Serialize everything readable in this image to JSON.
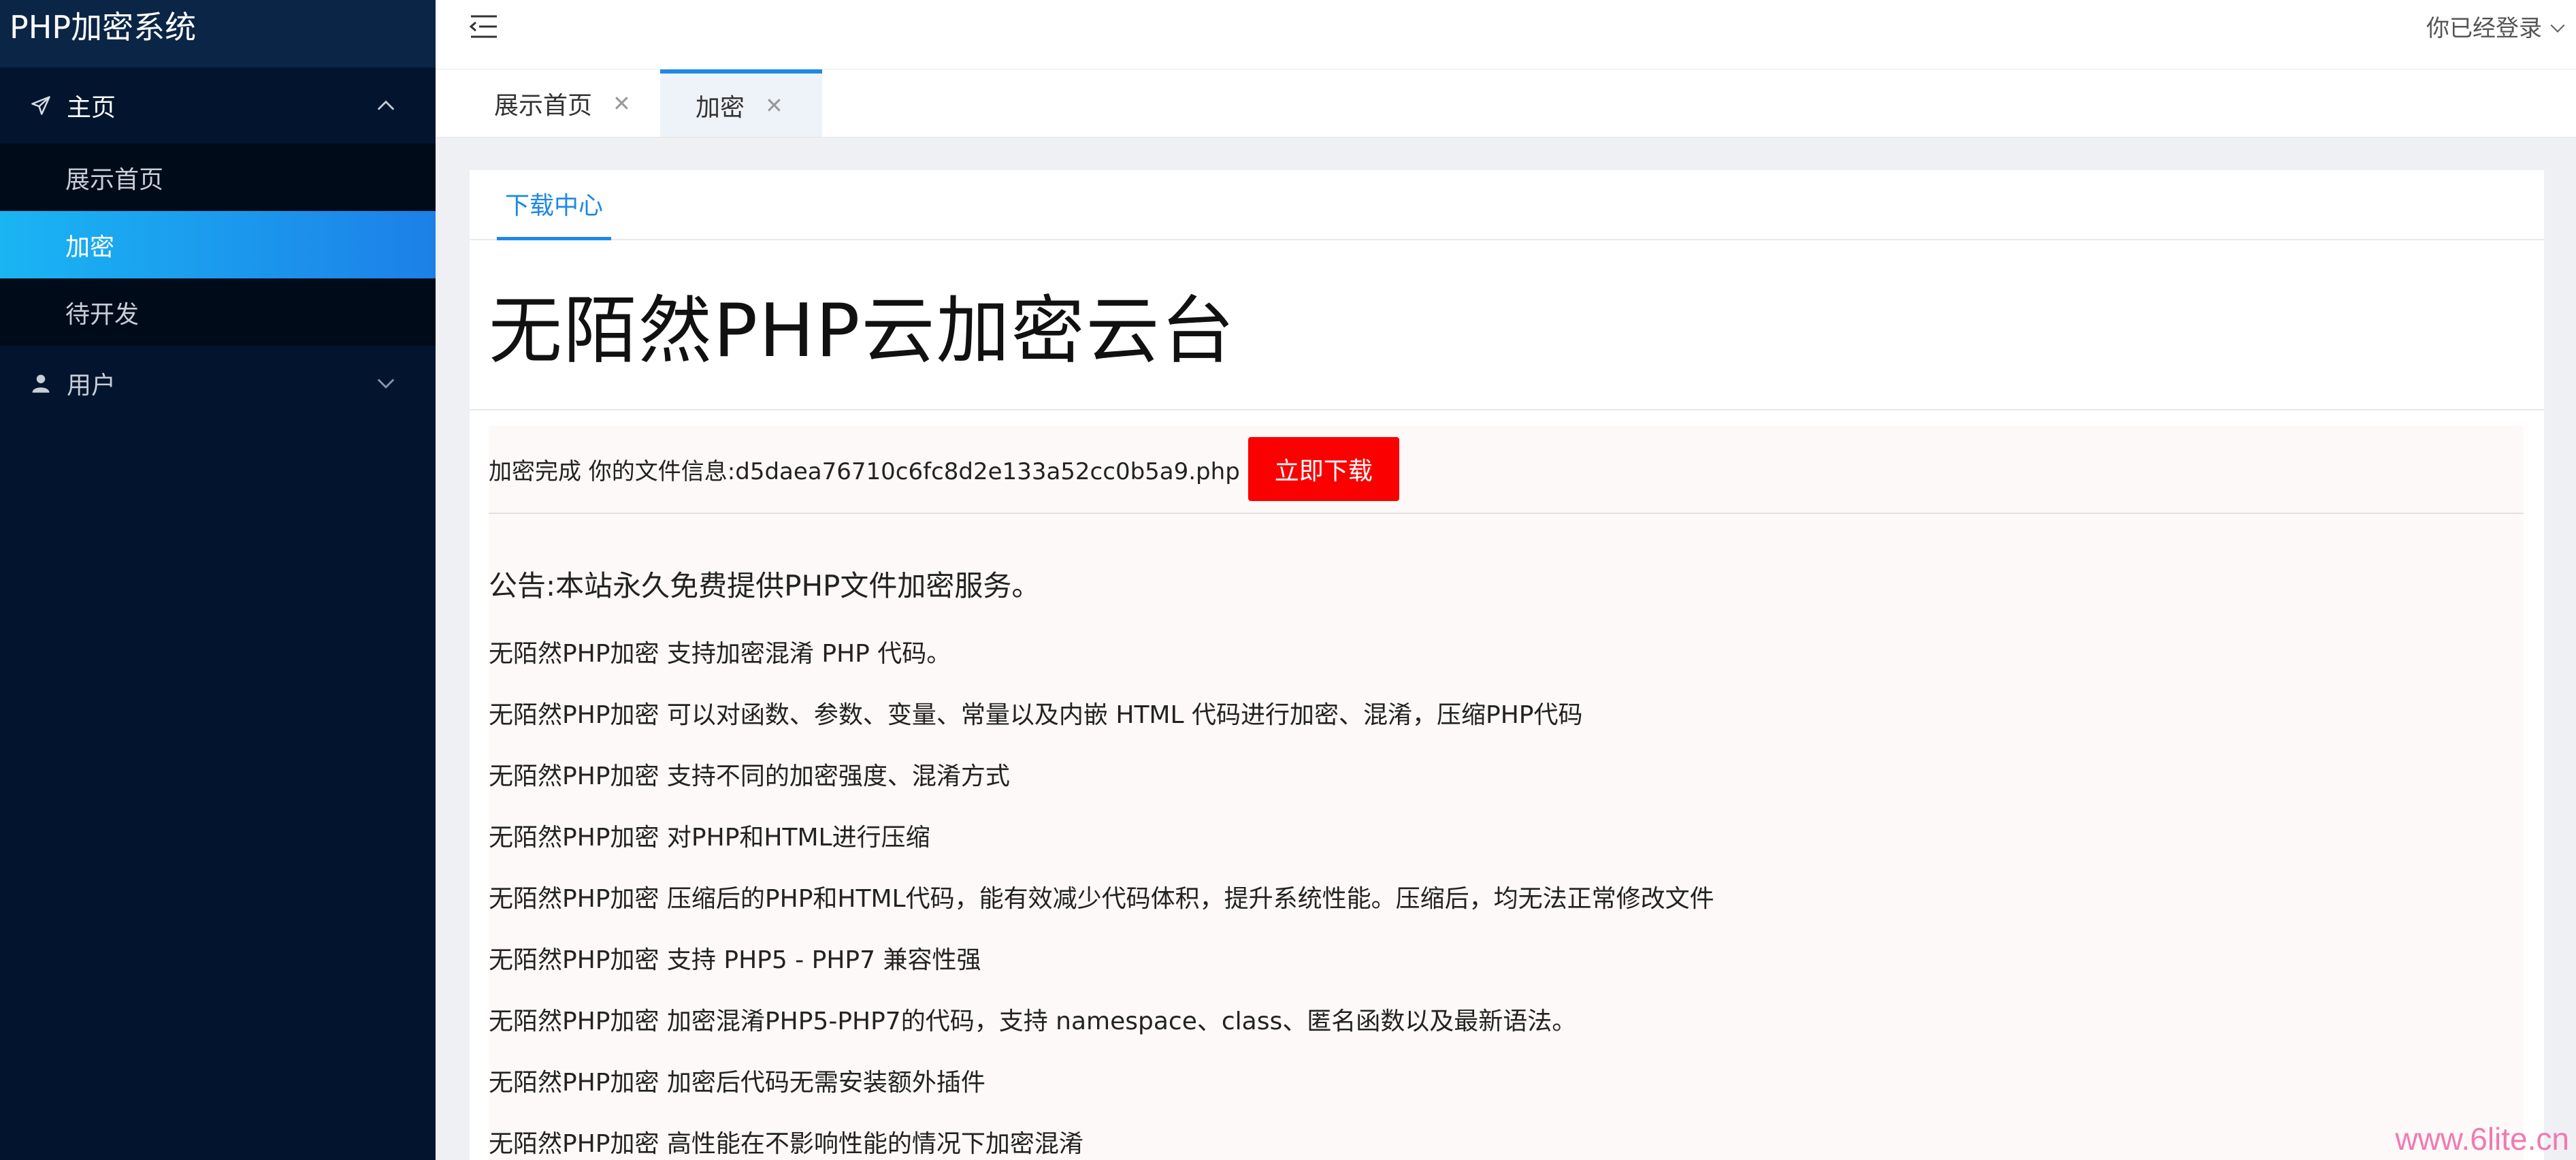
{
  "app": {
    "title": "PHP加密系统"
  },
  "sidebar": {
    "menu_home": {
      "label": "主页",
      "icon": "paper-plane-icon"
    },
    "sub_items": [
      {
        "label": "展示首页"
      },
      {
        "label": "加密"
      },
      {
        "label": "待开发"
      }
    ],
    "menu_user": {
      "label": "用户",
      "icon": "user-icon"
    }
  },
  "topbar": {
    "login_status": "你已经登录"
  },
  "tabs": [
    {
      "label": "展示首页"
    },
    {
      "label": "加密"
    }
  ],
  "content": {
    "sub_tab": "下载中心",
    "heading": "无陌然PHP云加密云台",
    "result_text": "加密完成 你的文件信息:d5daea76710c6fc8d2e133a52cc0b5a9.php",
    "download_button": "立即下载",
    "notice": "公告:本站永久免费提供PHP文件加密服务。",
    "features": [
      "无陌然PHP加密 支持加密混淆 PHP 代码。",
      "无陌然PHP加密 可以对函数、参数、变量、常量以及内嵌 HTML 代码进行加密、混淆，压缩PHP代码",
      "无陌然PHP加密 支持不同的加密强度、混淆方式",
      "无陌然PHP加密 对PHP和HTML进行压缩",
      "无陌然PHP加密 压缩后的PHP和HTML代码，能有效减少代码体积，提升系统性能。压缩后，均无法正常修改文件",
      "无陌然PHP加密 支持 PHP5 - PHP7 兼容性强",
      "无陌然PHP加密 加密混淆PHP5-PHP7的代码，支持 namespace、class、匿名函数以及最新语法。",
      "无陌然PHP加密 加密后代码无需安装额外插件",
      "无陌然PHP加密 高性能在不影响性能的情况下加密混淆"
    ]
  },
  "watermark": "www.6lite.cn",
  "colors": {
    "sidebar_bg": "#03152e",
    "active_item": "#1c80e8",
    "download_button": "#fb0000",
    "tab_accent": "#1e88e5"
  }
}
